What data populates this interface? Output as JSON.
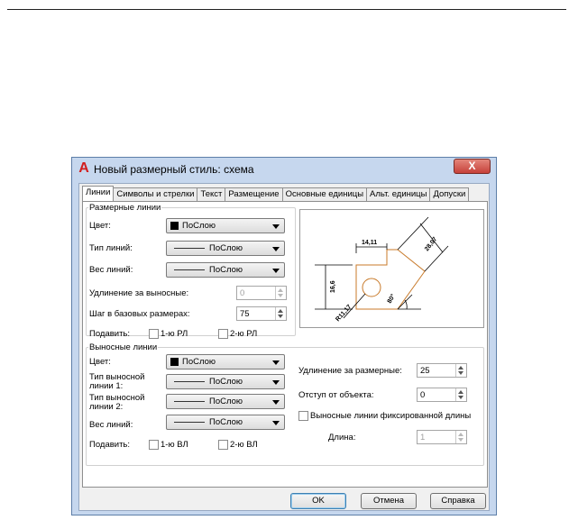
{
  "window": {
    "title": "Новый размерный стиль: схема",
    "close_symbol": "X",
    "app_icon_glyph": "A"
  },
  "tabs": [
    "Линии",
    "Символы и стрелки",
    "Текст",
    "Размещение",
    "Основные единицы",
    "Альт. единицы",
    "Допуски"
  ],
  "dim_lines": {
    "group_label": "Размерные линии",
    "color_label": "Цвет:",
    "color_value": "ПоСлою",
    "linetype_label": "Тип линий:",
    "linetype_value": "ПоСлою",
    "lineweight_label": "Вес линий:",
    "lineweight_value": "ПоСлою",
    "extend_label": "Удлинение за выносные:",
    "extend_value": "0",
    "baseline_label": "Шаг в базовых размерах:",
    "baseline_value": "75",
    "suppress_label": "Подавить:",
    "suppress_1": "1-ю РЛ",
    "suppress_2": "2-ю РЛ"
  },
  "ext_lines": {
    "group_label": "Выносные линии",
    "color_label": "Цвет:",
    "color_value": "ПоСлою",
    "linetype1_label_a": "Тип выносной",
    "linetype1_label_b": "линии 1:",
    "linetype1_value": "ПоСлою",
    "linetype2_label_a": "Тип выносной",
    "linetype2_label_b": "линии 2:",
    "linetype2_value": "ПоСлою",
    "lineweight_label": "Вес линий:",
    "lineweight_value": "ПоСлою",
    "suppress_label": "Подавить:",
    "suppress_1": "1-ю ВЛ",
    "suppress_2": "2-ю ВЛ",
    "extend_label": "Удлинение за размерные:",
    "extend_value": "25",
    "offset_label": "Отступ от объекта:",
    "offset_value": "0",
    "fixed_label": "Выносные линии фиксированной длины",
    "length_label": "Длина:",
    "length_value": "1"
  },
  "preview": {
    "dim_top": "14,11",
    "dim_left": "16,6",
    "dim_diag": "28,07",
    "dim_angle": "80°",
    "dim_radius": "R11,17"
  },
  "buttons": {
    "ok": "OK",
    "cancel": "Отмена",
    "help": "Справка"
  },
  "colors": {
    "titlebar": "#c6d7ee",
    "close_button": "#c6413a",
    "preview_outline": "#c87a2a"
  }
}
